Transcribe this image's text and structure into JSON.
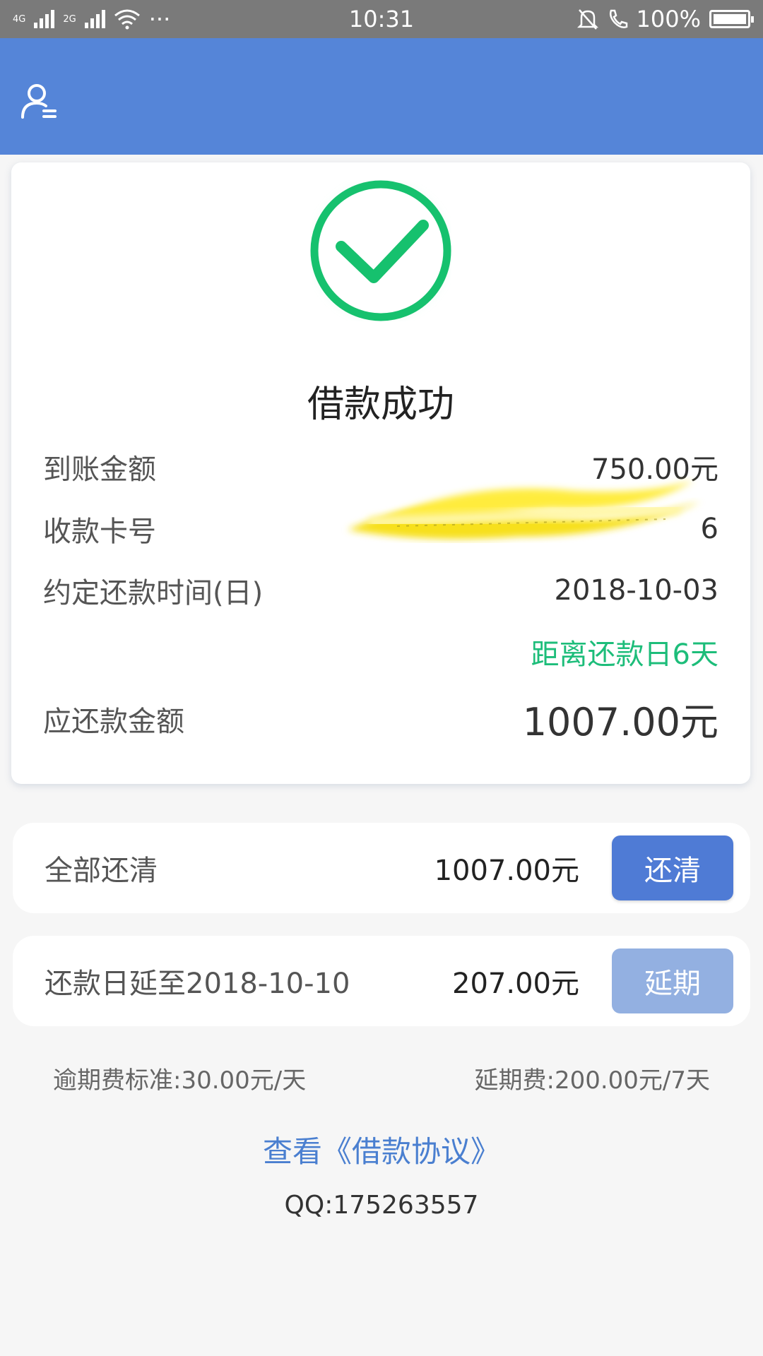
{
  "status_bar": {
    "network_1": "4G",
    "network_2": "2G",
    "more": "···",
    "time": "10:31",
    "battery": "100%",
    "battery_level": 1.0
  },
  "header": {
    "user_icon": "user-list-icon",
    "color": "#5585d8"
  },
  "result": {
    "icon": "check-circle-icon",
    "title": "借款成功"
  },
  "details": {
    "received_label": "到账金额",
    "received_value": "750.00元",
    "card_label": "收款卡号",
    "card_value": "6",
    "due_label": "约定还款时间(日)",
    "due_value": "2018-10-03",
    "countdown": "距离还款日6天",
    "repay_label": "应还款金额",
    "repay_value": "1007.00元"
  },
  "actions": {
    "full_label": "全部还清",
    "full_amount": "1007.00元",
    "full_button": "还清",
    "extend_label": "还款日延至2018-10-10",
    "extend_amount": "207.00元",
    "extend_button": "延期"
  },
  "fees": {
    "overdue": "逾期费标准:30.00元/天",
    "extension": "延期费:200.00元/7天"
  },
  "footer": {
    "agreement_link": "查看《借款协议》",
    "qq": "QQ:175263557"
  },
  "colors": {
    "accent": "#5585d8",
    "success": "#1dbd7a",
    "link": "#4a7fd0"
  }
}
